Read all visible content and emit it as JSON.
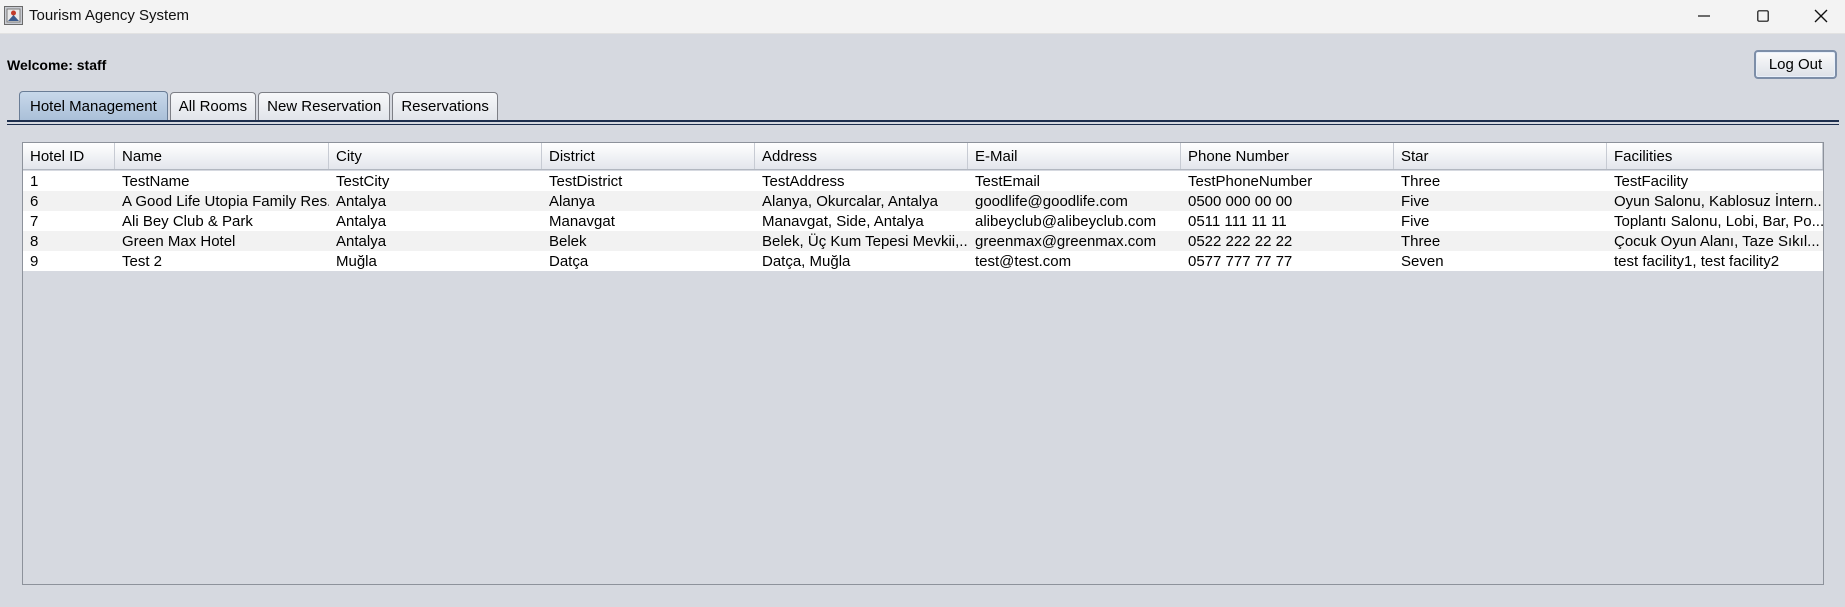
{
  "window": {
    "title": "Tourism Agency System"
  },
  "header": {
    "welcome": "Welcome: staff",
    "logout_label": "Log Out"
  },
  "tabs": [
    {
      "label": "Hotel Management",
      "active": true
    },
    {
      "label": "All Rooms",
      "active": false
    },
    {
      "label": "New Reservation",
      "active": false
    },
    {
      "label": "Reservations",
      "active": false
    }
  ],
  "table": {
    "columns": [
      "Hotel ID",
      "Name",
      "City",
      "District",
      "Address",
      "E-Mail",
      "Phone Number",
      "Star",
      "Facilities"
    ],
    "rows": [
      [
        "1",
        "TestName",
        "TestCity",
        "TestDistrict",
        "TestAddress",
        "TestEmail",
        "TestPhoneNumber",
        "Three",
        "TestFacility"
      ],
      [
        "6",
        "A Good Life Utopia Family Res...",
        "Antalya",
        "Alanya",
        "Alanya, Okurcalar, Antalya",
        "goodlife@goodlife.com",
        "0500 000 00 00",
        "Five",
        "Oyun Salonu, Kablosuz İntern..."
      ],
      [
        "7",
        "Ali Bey Club & Park",
        "Antalya",
        "Manavgat",
        "Manavgat, Side, Antalya",
        "alibeyclub@alibeyclub.com",
        "0511 111 11 11",
        "Five",
        "Toplantı Salonu, Lobi, Bar, Po..."
      ],
      [
        "8",
        "Green Max Hotel",
        "Antalya",
        "Belek",
        "Belek, Üç Kum Tepesi Mevkii,...",
        "greenmax@greenmax.com",
        "0522 222 22 22",
        "Three",
        "Çocuk Oyun Alanı, Taze Sıkıl..."
      ],
      [
        "9",
        "Test 2",
        "Muğla",
        "Datça",
        "Datça, Muğla",
        "test@test.com",
        "0577 777 77 77",
        "Seven",
        "test facility1, test facility2"
      ]
    ]
  },
  "icons": {
    "app": "app-icon",
    "minimize": "minimize-icon",
    "maximize": "maximize-icon",
    "close": "close-icon"
  },
  "colors": {
    "background": "#d6d9e0",
    "active_tab": "#b6c9df",
    "tab_underline": "#1e2f4e"
  }
}
